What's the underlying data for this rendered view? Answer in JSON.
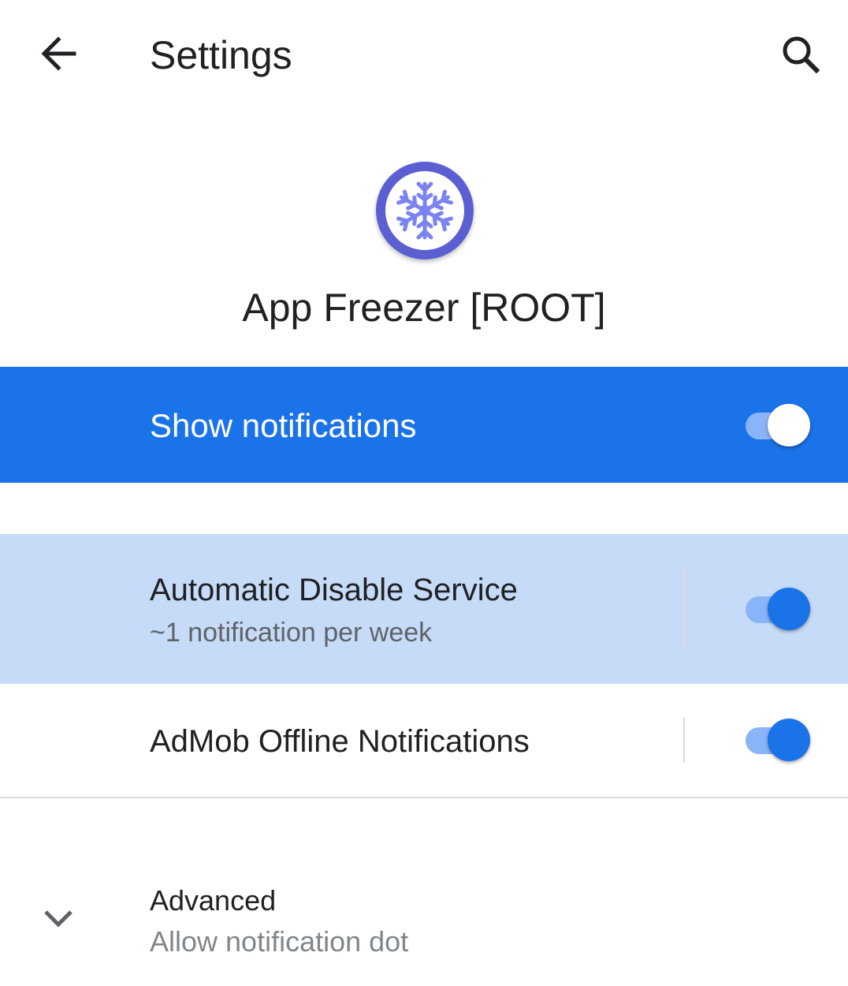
{
  "toolbar": {
    "title": "Settings",
    "back_icon": "arrow-back-icon",
    "search_icon": "search-icon"
  },
  "app": {
    "name": "App Freezer [ROOT]",
    "icon": "snowflake-icon"
  },
  "master": {
    "label": "Show notifications",
    "enabled": true
  },
  "channels": [
    {
      "title": "Automatic Disable Service",
      "subtitle": "~1 notification per week",
      "enabled": true
    },
    {
      "title": "AdMob Offline Notifications",
      "enabled": true
    }
  ],
  "advanced": {
    "title": "Advanced",
    "subtitle": "Allow notification dot",
    "icon": "chevron-down-icon"
  },
  "colors": {
    "accent": "#1a73e8",
    "highlight_row": "#c6dbf7",
    "switch_track": "#8ab4f8",
    "icon_ring": "#5b5fd1",
    "snowflake": "#7b83f0"
  }
}
